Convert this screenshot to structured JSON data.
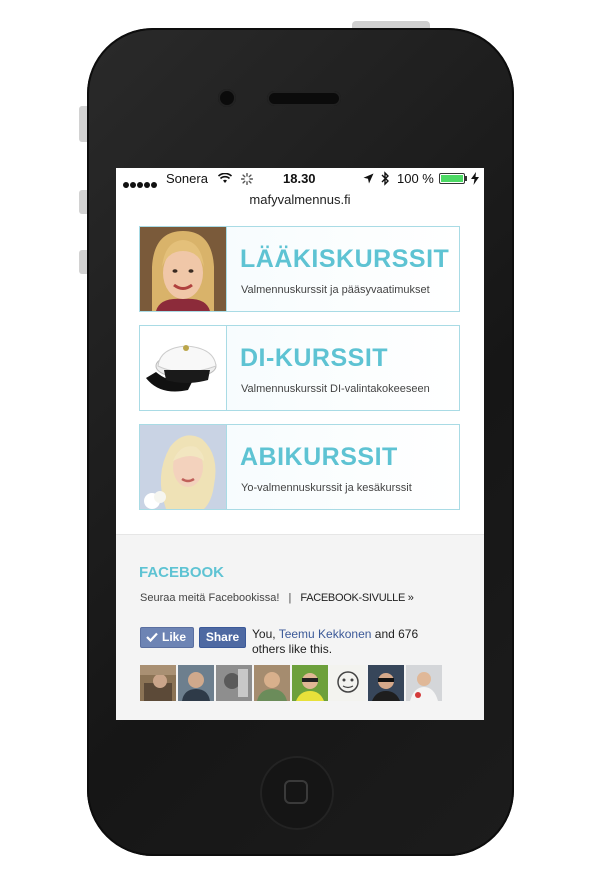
{
  "status": {
    "carrier": "Sonera",
    "time": "18.30",
    "battery": "100 %",
    "battery_level": 1.0
  },
  "browser": {
    "url": "mafyvalmennus.fi"
  },
  "courses": [
    {
      "title": "LÄÄKISKURSSIT",
      "subtitle": "Valmennuskurssit ja pääsyvaatimukset"
    },
    {
      "title": "DI-KURSSIT",
      "subtitle": "Valmennuskurssit DI-valintakokeeseen"
    },
    {
      "title": "ABIKURSSIT",
      "subtitle": "Yo-valmennuskurssit ja kesäkurssit"
    }
  ],
  "facebook": {
    "heading": "FACEBOOK",
    "follow_text": "Seuraa meitä Facebookissa!",
    "separator": "|",
    "link_text": "FACEBOOK-SIVULLE »",
    "like_label": "Like",
    "share_label": "Share",
    "social_prefix": "You, ",
    "friend_name": "Teemu Kekkonen",
    "social_suffix": " and 676 others like this."
  },
  "colors": {
    "accent": "#5ec3d3",
    "facebook_blue": "#3b5998",
    "battery_green": "#4cd964"
  },
  "icons": [
    "wifi-icon",
    "activity-spinner-icon",
    "location-arrow-icon",
    "bluetooth-icon",
    "battery-icon",
    "charging-bolt-icon",
    "thumbs-up-icon"
  ]
}
